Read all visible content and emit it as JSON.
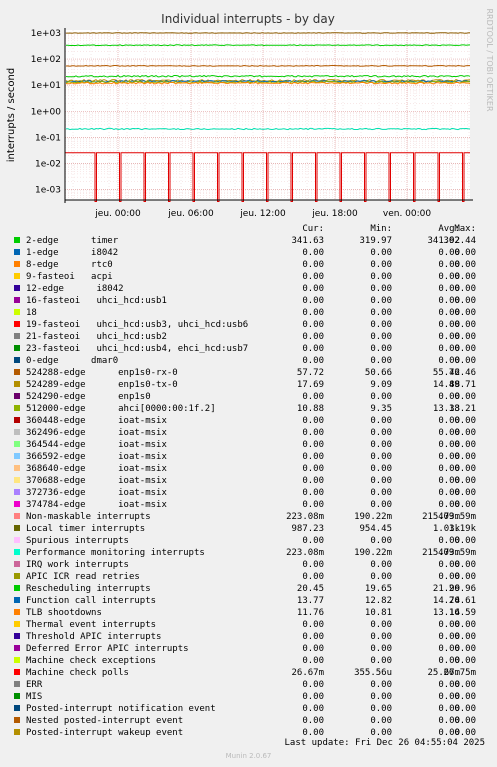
{
  "chart_data": {
    "type": "line",
    "title": "Individual interrupts - by day",
    "ylabel": "interrupts / second",
    "yscale": "log",
    "ylim": [
      0.0004,
      1300
    ],
    "yticks": [
      "1e+03",
      "1e+02",
      "1e+01",
      "1e+00",
      "1e-01",
      "1e-02",
      "1e-03"
    ],
    "xticks": [
      "jeu. 00:00",
      "jeu. 06:00",
      "jeu. 12:00",
      "jeu. 18:00",
      "ven. 00:00"
    ],
    "grid": true,
    "series": [
      {
        "name": "Local timer interrupts",
        "approx_value": 990,
        "color": "#8c5b00"
      },
      {
        "name": "2-edge",
        "approx_value": 342,
        "color": "#00cc00"
      },
      {
        "name": "Non-maskable interrupts",
        "approx_value": 0.22,
        "color": "#ff00ff"
      },
      {
        "name": "524288-edge",
        "approx_value": 55,
        "color": "#8c2d0a"
      },
      {
        "name": "Machine check polls",
        "approx_value": 0.027,
        "color": "#e00000"
      }
    ]
  },
  "legend_headers": {
    "cur": "Cur:",
    "min": "Min:",
    "avg": "Avg:",
    "max": "Max:"
  },
  "legend": [
    {
      "name": "2-edge      timer",
      "color": "#00cc00",
      "cur": "341.63",
      "min": "319.97",
      "avg": "341.92",
      "max": "362.44"
    },
    {
      "name": "1-edge      i8042",
      "color": "#0066b3",
      "cur": "0.00",
      "min": "0.00",
      "avg": "0.00",
      "max": "0.00"
    },
    {
      "name": "8-edge      rtc0",
      "color": "#ff8000",
      "cur": "0.00",
      "min": "0.00",
      "avg": "0.00",
      "max": "0.00"
    },
    {
      "name": "9-fasteoi   acpi",
      "color": "#ffcc00",
      "cur": "0.00",
      "min": "0.00",
      "avg": "0.00",
      "max": "0.00"
    },
    {
      "name": "12-edge      i8042",
      "color": "#330099",
      "cur": "0.00",
      "min": "0.00",
      "avg": "0.00",
      "max": "0.00"
    },
    {
      "name": "16-fasteoi   uhci_hcd:usb1",
      "color": "#990099",
      "cur": "0.00",
      "min": "0.00",
      "avg": "0.00",
      "max": "0.00"
    },
    {
      "name": "18",
      "color": "#ccff00",
      "cur": "0.00",
      "min": "0.00",
      "avg": "0.00",
      "max": "0.00"
    },
    {
      "name": "19-fasteoi   uhci_hcd:usb3, uhci_hcd:usb6",
      "color": "#ff0000",
      "cur": "0.00",
      "min": "0.00",
      "avg": "0.00",
      "max": "0.00"
    },
    {
      "name": "21-fasteoi   uhci_hcd:usb2",
      "color": "#808080",
      "cur": "0.00",
      "min": "0.00",
      "avg": "0.00",
      "max": "0.00"
    },
    {
      "name": "23-fasteoi   uhci_hcd:usb4, ehci_hcd:usb7",
      "color": "#008f00",
      "cur": "0.00",
      "min": "0.00",
      "avg": "0.00",
      "max": "0.00"
    },
    {
      "name": "0-edge      dmar0",
      "color": "#00487d",
      "cur": "0.00",
      "min": "0.00",
      "avg": "0.00",
      "max": "0.00"
    },
    {
      "name": "524288-edge      enp1s0-rx-0",
      "color": "#b35a00",
      "cur": "57.72",
      "min": "50.66",
      "avg": "55.42",
      "max": "76.46"
    },
    {
      "name": "524289-edge      enp1s0-tx-0",
      "color": "#b38f00",
      "cur": "17.69",
      "min": "9.09",
      "avg": "14.88",
      "max": "49.71"
    },
    {
      "name": "524290-edge      enp1s0",
      "color": "#6b006b",
      "cur": "0.00",
      "min": "0.00",
      "avg": "0.00",
      "max": "0.00"
    },
    {
      "name": "512000-edge      ahci[0000:00:1f.2]",
      "color": "#8fb300",
      "cur": "10.88",
      "min": "9.35",
      "avg": "13.33",
      "max": "18.21"
    },
    {
      "name": "360448-edge      ioat-msix",
      "color": "#b30000",
      "cur": "0.00",
      "min": "0.00",
      "avg": "0.00",
      "max": "0.00"
    },
    {
      "name": "362496-edge      ioat-msix",
      "color": "#bebebe",
      "cur": "0.00",
      "min": "0.00",
      "avg": "0.00",
      "max": "0.00"
    },
    {
      "name": "364544-edge      ioat-msix",
      "color": "#80ff80",
      "cur": "0.00",
      "min": "0.00",
      "avg": "0.00",
      "max": "0.00"
    },
    {
      "name": "366592-edge      ioat-msix",
      "color": "#80c9ff",
      "cur": "0.00",
      "min": "0.00",
      "avg": "0.00",
      "max": "0.00"
    },
    {
      "name": "368640-edge      ioat-msix",
      "color": "#ffc080",
      "cur": "0.00",
      "min": "0.00",
      "avg": "0.00",
      "max": "0.00"
    },
    {
      "name": "370688-edge      ioat-msix",
      "color": "#ffe680",
      "cur": "0.00",
      "min": "0.00",
      "avg": "0.00",
      "max": "0.00"
    },
    {
      "name": "372736-edge      ioat-msix",
      "color": "#aa80ff",
      "cur": "0.00",
      "min": "0.00",
      "avg": "0.00",
      "max": "0.00"
    },
    {
      "name": "374784-edge      ioat-msix",
      "color": "#ee00cc",
      "cur": "0.00",
      "min": "0.00",
      "avg": "0.00",
      "max": "0.00"
    },
    {
      "name": "Non-maskable interrupts",
      "color": "#ff8080",
      "cur": "223.08m",
      "min": "190.22m",
      "avg": "215.73m",
      "max": "409.59m"
    },
    {
      "name": "Local timer interrupts",
      "color": "#666600",
      "cur": "987.23",
      "min": "954.45",
      "avg": "1.03k",
      "max": "1.19k"
    },
    {
      "name": "Spurious interrupts",
      "color": "#ffbfff",
      "cur": "0.00",
      "min": "0.00",
      "avg": "0.00",
      "max": "0.00"
    },
    {
      "name": "Performance monitoring interrupts",
      "color": "#00ffcc",
      "cur": "223.08m",
      "min": "190.22m",
      "avg": "215.73m",
      "max": "409.59m"
    },
    {
      "name": "IRQ work interrupts",
      "color": "#cc6699",
      "cur": "0.00",
      "min": "0.00",
      "avg": "0.00",
      "max": "0.00"
    },
    {
      "name": "APIC ICR read retries",
      "color": "#999900",
      "cur": "0.00",
      "min": "0.00",
      "avg": "0.00",
      "max": "0.00"
    },
    {
      "name": "Rescheduling interrupts",
      "color": "#00cc00",
      "cur": "20.45",
      "min": "19.65",
      "avg": "21.99",
      "max": "26.96"
    },
    {
      "name": "Function call interrupts",
      "color": "#0066b3",
      "cur": "13.77",
      "min": "12.82",
      "avg": "14.74",
      "max": "20.61"
    },
    {
      "name": "TLB shootdowns",
      "color": "#ff8000",
      "cur": "11.76",
      "min": "10.81",
      "avg": "13.14",
      "max": "16.59"
    },
    {
      "name": "Thermal event interrupts",
      "color": "#ffcc00",
      "cur": "0.00",
      "min": "0.00",
      "avg": "0.00",
      "max": "0.00"
    },
    {
      "name": "Threshold APIC interrupts",
      "color": "#330099",
      "cur": "0.00",
      "min": "0.00",
      "avg": "0.00",
      "max": "0.00"
    },
    {
      "name": "Deferred Error APIC interrupts",
      "color": "#990099",
      "cur": "0.00",
      "min": "0.00",
      "avg": "0.00",
      "max": "0.00"
    },
    {
      "name": "Machine check exceptions",
      "color": "#ccff00",
      "cur": "0.00",
      "min": "0.00",
      "avg": "0.00",
      "max": "0.00"
    },
    {
      "name": "Machine check polls",
      "color": "#ff0000",
      "cur": "26.67m",
      "min": "355.56u",
      "avg": "25.67m",
      "max": "26.75m"
    },
    {
      "name": "ERR",
      "color": "#808080",
      "cur": "0.00",
      "min": "0.00",
      "avg": "0.00",
      "max": "0.00"
    },
    {
      "name": "MIS",
      "color": "#008f00",
      "cur": "0.00",
      "min": "0.00",
      "avg": "0.00",
      "max": "0.00"
    },
    {
      "name": "Posted-interrupt notification event",
      "color": "#00487d",
      "cur": "0.00",
      "min": "0.00",
      "avg": "0.00",
      "max": "0.00"
    },
    {
      "name": "Nested posted-interrupt event",
      "color": "#b35a00",
      "cur": "0.00",
      "min": "0.00",
      "avg": "0.00",
      "max": "0.00"
    },
    {
      "name": "Posted-interrupt wakeup event",
      "color": "#b38f00",
      "cur": "0.00",
      "min": "0.00",
      "avg": "0.00",
      "max": "0.00"
    }
  ],
  "last_update": "Last update:  Fri Dec 26 04:55:04 2025",
  "side_label": "RRDTOOL / TOBI OETIKER",
  "munin_version": "Munin 2.0.67"
}
